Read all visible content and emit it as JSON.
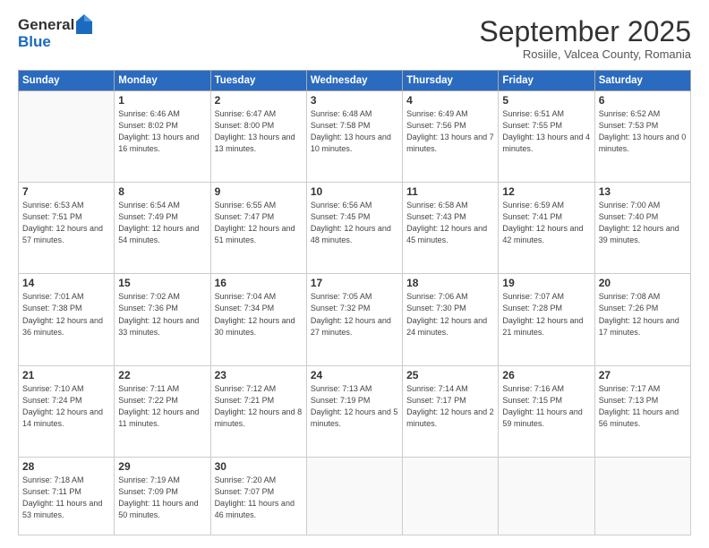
{
  "logo": {
    "general": "General",
    "blue": "Blue"
  },
  "header": {
    "month": "September 2025",
    "location": "Rosiile, Valcea County, Romania"
  },
  "weekdays": [
    "Sunday",
    "Monday",
    "Tuesday",
    "Wednesday",
    "Thursday",
    "Friday",
    "Saturday"
  ],
  "weeks": [
    [
      {
        "day": "",
        "sunrise": "",
        "sunset": "",
        "daylight": ""
      },
      {
        "day": "1",
        "sunrise": "Sunrise: 6:46 AM",
        "sunset": "Sunset: 8:02 PM",
        "daylight": "Daylight: 13 hours and 16 minutes."
      },
      {
        "day": "2",
        "sunrise": "Sunrise: 6:47 AM",
        "sunset": "Sunset: 8:00 PM",
        "daylight": "Daylight: 13 hours and 13 minutes."
      },
      {
        "day": "3",
        "sunrise": "Sunrise: 6:48 AM",
        "sunset": "Sunset: 7:58 PM",
        "daylight": "Daylight: 13 hours and 10 minutes."
      },
      {
        "day": "4",
        "sunrise": "Sunrise: 6:49 AM",
        "sunset": "Sunset: 7:56 PM",
        "daylight": "Daylight: 13 hours and 7 minutes."
      },
      {
        "day": "5",
        "sunrise": "Sunrise: 6:51 AM",
        "sunset": "Sunset: 7:55 PM",
        "daylight": "Daylight: 13 hours and 4 minutes."
      },
      {
        "day": "6",
        "sunrise": "Sunrise: 6:52 AM",
        "sunset": "Sunset: 7:53 PM",
        "daylight": "Daylight: 13 hours and 0 minutes."
      }
    ],
    [
      {
        "day": "7",
        "sunrise": "Sunrise: 6:53 AM",
        "sunset": "Sunset: 7:51 PM",
        "daylight": "Daylight: 12 hours and 57 minutes."
      },
      {
        "day": "8",
        "sunrise": "Sunrise: 6:54 AM",
        "sunset": "Sunset: 7:49 PM",
        "daylight": "Daylight: 12 hours and 54 minutes."
      },
      {
        "day": "9",
        "sunrise": "Sunrise: 6:55 AM",
        "sunset": "Sunset: 7:47 PM",
        "daylight": "Daylight: 12 hours and 51 minutes."
      },
      {
        "day": "10",
        "sunrise": "Sunrise: 6:56 AM",
        "sunset": "Sunset: 7:45 PM",
        "daylight": "Daylight: 12 hours and 48 minutes."
      },
      {
        "day": "11",
        "sunrise": "Sunrise: 6:58 AM",
        "sunset": "Sunset: 7:43 PM",
        "daylight": "Daylight: 12 hours and 45 minutes."
      },
      {
        "day": "12",
        "sunrise": "Sunrise: 6:59 AM",
        "sunset": "Sunset: 7:41 PM",
        "daylight": "Daylight: 12 hours and 42 minutes."
      },
      {
        "day": "13",
        "sunrise": "Sunrise: 7:00 AM",
        "sunset": "Sunset: 7:40 PM",
        "daylight": "Daylight: 12 hours and 39 minutes."
      }
    ],
    [
      {
        "day": "14",
        "sunrise": "Sunrise: 7:01 AM",
        "sunset": "Sunset: 7:38 PM",
        "daylight": "Daylight: 12 hours and 36 minutes."
      },
      {
        "day": "15",
        "sunrise": "Sunrise: 7:02 AM",
        "sunset": "Sunset: 7:36 PM",
        "daylight": "Daylight: 12 hours and 33 minutes."
      },
      {
        "day": "16",
        "sunrise": "Sunrise: 7:04 AM",
        "sunset": "Sunset: 7:34 PM",
        "daylight": "Daylight: 12 hours and 30 minutes."
      },
      {
        "day": "17",
        "sunrise": "Sunrise: 7:05 AM",
        "sunset": "Sunset: 7:32 PM",
        "daylight": "Daylight: 12 hours and 27 minutes."
      },
      {
        "day": "18",
        "sunrise": "Sunrise: 7:06 AM",
        "sunset": "Sunset: 7:30 PM",
        "daylight": "Daylight: 12 hours and 24 minutes."
      },
      {
        "day": "19",
        "sunrise": "Sunrise: 7:07 AM",
        "sunset": "Sunset: 7:28 PM",
        "daylight": "Daylight: 12 hours and 21 minutes."
      },
      {
        "day": "20",
        "sunrise": "Sunrise: 7:08 AM",
        "sunset": "Sunset: 7:26 PM",
        "daylight": "Daylight: 12 hours and 17 minutes."
      }
    ],
    [
      {
        "day": "21",
        "sunrise": "Sunrise: 7:10 AM",
        "sunset": "Sunset: 7:24 PM",
        "daylight": "Daylight: 12 hours and 14 minutes."
      },
      {
        "day": "22",
        "sunrise": "Sunrise: 7:11 AM",
        "sunset": "Sunset: 7:22 PM",
        "daylight": "Daylight: 12 hours and 11 minutes."
      },
      {
        "day": "23",
        "sunrise": "Sunrise: 7:12 AM",
        "sunset": "Sunset: 7:21 PM",
        "daylight": "Daylight: 12 hours and 8 minutes."
      },
      {
        "day": "24",
        "sunrise": "Sunrise: 7:13 AM",
        "sunset": "Sunset: 7:19 PM",
        "daylight": "Daylight: 12 hours and 5 minutes."
      },
      {
        "day": "25",
        "sunrise": "Sunrise: 7:14 AM",
        "sunset": "Sunset: 7:17 PM",
        "daylight": "Daylight: 12 hours and 2 minutes."
      },
      {
        "day": "26",
        "sunrise": "Sunrise: 7:16 AM",
        "sunset": "Sunset: 7:15 PM",
        "daylight": "Daylight: 11 hours and 59 minutes."
      },
      {
        "day": "27",
        "sunrise": "Sunrise: 7:17 AM",
        "sunset": "Sunset: 7:13 PM",
        "daylight": "Daylight: 11 hours and 56 minutes."
      }
    ],
    [
      {
        "day": "28",
        "sunrise": "Sunrise: 7:18 AM",
        "sunset": "Sunset: 7:11 PM",
        "daylight": "Daylight: 11 hours and 53 minutes."
      },
      {
        "day": "29",
        "sunrise": "Sunrise: 7:19 AM",
        "sunset": "Sunset: 7:09 PM",
        "daylight": "Daylight: 11 hours and 50 minutes."
      },
      {
        "day": "30",
        "sunrise": "Sunrise: 7:20 AM",
        "sunset": "Sunset: 7:07 PM",
        "daylight": "Daylight: 11 hours and 46 minutes."
      },
      {
        "day": "",
        "sunrise": "",
        "sunset": "",
        "daylight": ""
      },
      {
        "day": "",
        "sunrise": "",
        "sunset": "",
        "daylight": ""
      },
      {
        "day": "",
        "sunrise": "",
        "sunset": "",
        "daylight": ""
      },
      {
        "day": "",
        "sunrise": "",
        "sunset": "",
        "daylight": ""
      }
    ]
  ]
}
